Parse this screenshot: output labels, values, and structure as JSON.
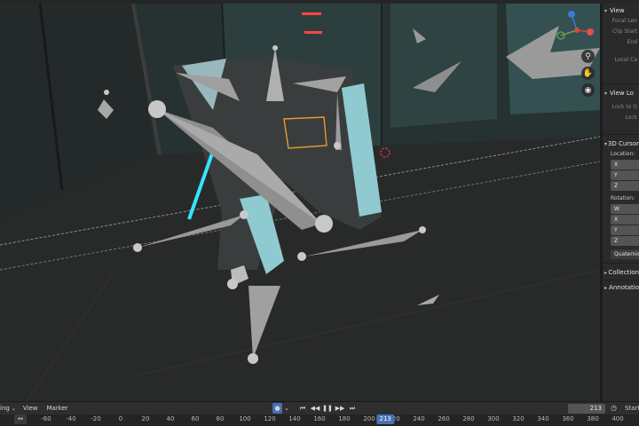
{
  "viewport": {
    "nav_icons": [
      "zoom-icon",
      "hand-icon",
      "camera-icon"
    ]
  },
  "npanel": {
    "view_header": "View",
    "focal_length": "Focal Len",
    "clip_start": "Clip Start",
    "clip_end": "End",
    "local_camera": "Local Ca",
    "view_lock_header": "View Lo",
    "lock_to_object": "Lock to O",
    "lock": "Lock",
    "cursor_header": "3D Cursor",
    "location_label": "Location:",
    "loc_axes": [
      "X",
      "Y",
      "Z"
    ],
    "rotation_label": "Rotation:",
    "rot_axes": [
      "W",
      "X",
      "Y",
      "Z"
    ],
    "rotation_mode": "Quaternion",
    "collections_header": "Collection",
    "annotations_header": "Annotatio"
  },
  "timeline": {
    "mode_label": "ing",
    "menus": [
      "View",
      "Marker"
    ],
    "current_frame": "213",
    "start_label": "Start",
    "ruler_ticks": [
      "-60",
      "-40",
      "-20",
      "0",
      "20",
      "40",
      "60",
      "80",
      "100",
      "120",
      "140",
      "160",
      "180",
      "200",
      "220",
      "240",
      "260",
      "280",
      "300",
      "320",
      "340",
      "360",
      "380",
      "400"
    ],
    "ruler_current": "213",
    "accent_color": "#4772b3"
  }
}
